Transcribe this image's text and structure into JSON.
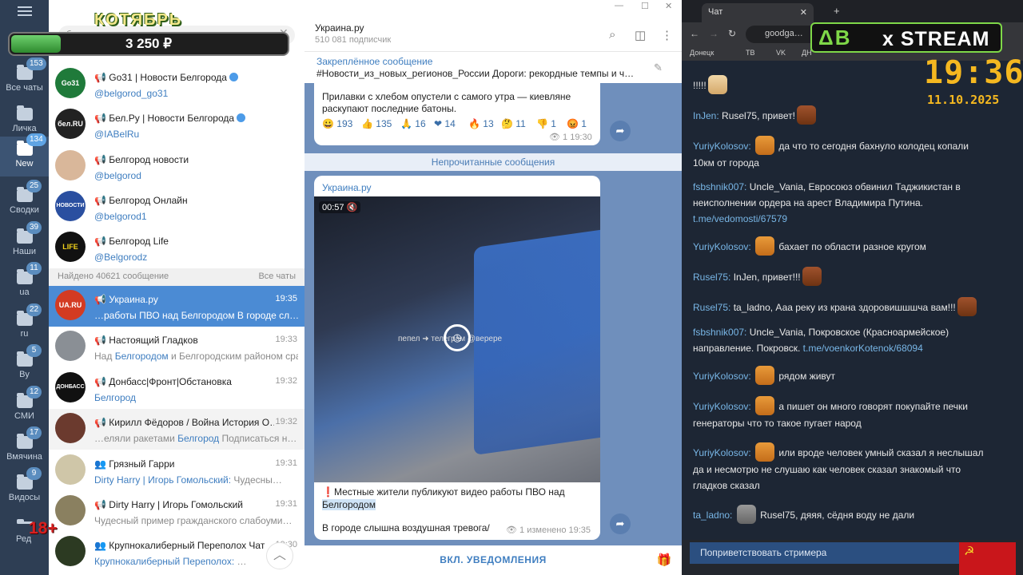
{
  "overlay": {
    "title": "КОТЯБРЬ",
    "balance": "3 250 ₽",
    "balance_progress": 0.18,
    "age_label": "18+",
    "stream_logo_ab": "ΔB",
    "stream_logo_text": "x STREAM",
    "clock": "19:36",
    "date": "11.10.2025"
  },
  "folders": [
    {
      "label": "Все чаты",
      "badge": "153"
    },
    {
      "label": "Личка",
      "badge": ""
    },
    {
      "label": "New",
      "badge": "134"
    },
    {
      "label": "Сводки",
      "badge": "25"
    },
    {
      "label": "Наши",
      "badge": "39"
    },
    {
      "label": "ua",
      "badge": "11"
    },
    {
      "label": "ru",
      "badge": "22"
    },
    {
      "label": "By",
      "badge": "5"
    },
    {
      "label": "СМИ",
      "badge": "12"
    },
    {
      "label": "Вмячина",
      "badge": "17"
    },
    {
      "label": "Видосы",
      "badge": "9"
    },
    {
      "label": "Ред",
      "badge": ""
    }
  ],
  "search": {
    "value": "белгород"
  },
  "channels": [
    {
      "name": "📢 Go31 | Новости Белгорода",
      "handle": "@belgorod_go31",
      "avatar_text": "Go31",
      "avatar_color": "#1f7a3a"
    },
    {
      "name": "📢 Бел.Ру | Новости Белгорода",
      "handle": "@IABelRu",
      "avatar_text": "бел.RU",
      "avatar_color": "#222222"
    },
    {
      "name": "📢 Белгород новости",
      "handle": "@belgorod",
      "avatar_text": "",
      "avatar_color": "#d9b79a"
    },
    {
      "name": "📢 Белгород Онлайн",
      "handle": "@belgorod1",
      "avatar_text": "НОВОСТИ",
      "avatar_color": "#2a4fa0"
    },
    {
      "name": "📢 Белгород Life",
      "handle": "@Belgorodz",
      "avatar_text": "LIFE",
      "avatar_color": "#111111"
    }
  ],
  "found": {
    "text": "Найдено 40621 сообщение",
    "all": "Все чаты"
  },
  "results": [
    {
      "name": "📢 Украина.ру",
      "time": "19:35",
      "preview": "…работы ПВО над Белгородом  В городе сл…",
      "avatar_text": "UA.RU",
      "avatar_color": "#d33b22",
      "selected": true
    },
    {
      "name": "📢 Настоящий Гладков",
      "time": "19:33",
      "preview_pre": "Над ",
      "preview_hl": "Белгородом",
      "preview_post": " и Белгородским районом сра…",
      "avatar_text": "",
      "avatar_color": "#8a8f95"
    },
    {
      "name": "📢 Донбасс|Фронт|Обстановка",
      "time": "19:32",
      "preview_pre": "",
      "preview_hl": "Белгород",
      "preview_post": "",
      "avatar_text": "ДОНБАСС",
      "avatar_color": "#111111"
    },
    {
      "name": "📢 Кирилл Фёдоров / Война История О…",
      "time": "19:32",
      "preview_pre": "…еляли ракетами ",
      "preview_hl": "Белгород",
      "preview_post": "  Подписаться н…",
      "avatar_text": "",
      "avatar_color": "#6b3a2e"
    },
    {
      "name": "👥 Грязный Гарри",
      "time": "19:31",
      "preview_pre": "",
      "preview_hl": "Dirty Harry | Игорь Гомольский:",
      "preview_post": " Чудесны…",
      "avatar_text": "",
      "avatar_color": "#cfc6a8"
    },
    {
      "name": "📢 Dirty Harry | Игорь Гомольский",
      "time": "19:31",
      "preview_pre": "Чудесный пример гражданского слабоуми…",
      "preview_hl": "",
      "preview_post": "",
      "avatar_text": "",
      "avatar_color": "#8a8060"
    },
    {
      "name": "👥 Крупнокалиберный Переполох Чат",
      "time": "19:30",
      "preview_pre": "",
      "preview_hl": "Крупнокалиберный Переполох:",
      "preview_post": " …",
      "avatar_text": "",
      "avatar_color": "#2c3a22"
    }
  ],
  "chat": {
    "window_title": "",
    "title": "Украина.ру",
    "subscribers": "510 081 подписчик",
    "pinned_label": "Закреплённое сообщение",
    "pinned_text": "#Новости_из_новых_регионов_России  Дороги: рекордные темпы и ч…",
    "msg1_text": "Прилавки с хлебом опустели с самого утра — киевляне раскупают последние батоны.",
    "reactions": [
      {
        "emoji": "😀",
        "count": "193"
      },
      {
        "emoji": "👍",
        "count": "135"
      },
      {
        "emoji": "🙏",
        "count": "16"
      },
      {
        "emoji": "❤",
        "count": "14"
      },
      {
        "emoji": "🔥",
        "count": "13"
      },
      {
        "emoji": "🤔",
        "count": "11"
      },
      {
        "emoji": "👎",
        "count": "1"
      },
      {
        "emoji": "😡",
        "count": "1"
      }
    ],
    "msg1_meta": "👁 1  19:30",
    "unread_label": "Непрочитанные сообщения",
    "msg2_source": "Украина.ру",
    "video_duration": "00:57",
    "video_caption": "пепел ➜ телеграм @верере",
    "msg2_text_pre": "❗Местные жители публикуют видео работы ПВО над ",
    "msg2_text_hl": "Белгородом",
    "msg2_text2": "В городе слышна воздушная тревога/",
    "msg2_meta": "👁 1  изменено 19:35",
    "footer": "ВКЛ. УВЕДОМЛЕНИЯ"
  },
  "browser": {
    "tab_title": "Чат",
    "url": "goodga…",
    "bookmarks": [
      "Донецк",
      "ТВ",
      "VK",
      "ДН"
    ],
    "messages": [
      {
        "user": "",
        "text": "!!!!!",
        "emote": "dog"
      },
      {
        "user": "InJen:",
        "text": "Rusel75, привет!",
        "emote": "beav"
      },
      {
        "user": "YuriyKolosov:",
        "text": "да что то сегодня бахнуло колодец копали 10км от города",
        "emote": "fry"
      },
      {
        "user": "fsbshnik007:",
        "text": "Uncle_Vania, Евросоюз обвинил Таджикистан в неисполнении ордера на арест Владимира Путина.",
        "link": "t.me/vedomosti/67579"
      },
      {
        "user": "YuriyKolosov:",
        "text": "бахает по области разное кругом",
        "emote": "fry"
      },
      {
        "user": "Rusel75:",
        "text": "InJen, привет!!!",
        "emote": "beav"
      },
      {
        "user": "Rusel75:",
        "text": "ta_ladno, Ааа реку из крана здоровишшшча вам!!!",
        "emote": "beav"
      },
      {
        "user": "fsbshnik007:",
        "text": "Uncle_Vania, Покровское (Красноармейское) направление. Покровск.",
        "link": "t.me/voenkorKotenok/68094"
      },
      {
        "user": "YuriyKolosov:",
        "text": "рядом живут",
        "emote": "fry"
      },
      {
        "user": "YuriyKolosov:",
        "text": "а пишет он много говорят покупайте печки генераторы что то такое пугает народ",
        "emote": "fry"
      },
      {
        "user": "YuriyKolosov:",
        "text": "или вроде человек умный сказал я неслышал да и несмотрю не слушаю как человек сказал знакомый что гладков сказал",
        "emote": "fry"
      },
      {
        "user": "ta_ladno:",
        "text": "Rusel75,  дяяя, сёдня воду не дали",
        "emote": "cat"
      }
    ],
    "greet_button": "Поприветствовать стримера"
  }
}
